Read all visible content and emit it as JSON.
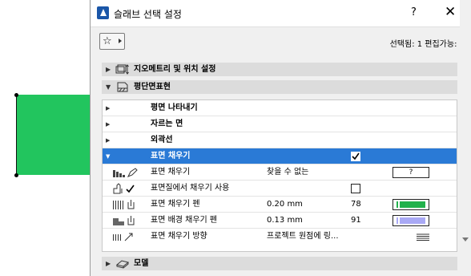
{
  "dialog": {
    "title": "슬래브 선택 설정",
    "help_label": "?",
    "close_label": "✕",
    "favorites_label": "☆",
    "selected_info": "선택됨: 1 편집가능: 1"
  },
  "sections": {
    "geometry": {
      "label": "지오메트리 및 위치 설정",
      "expanded": false
    },
    "floor_plan": {
      "label": "평단면표현",
      "expanded": true
    },
    "model": {
      "label": "모델",
      "expanded": false
    }
  },
  "tree": {
    "rows": [
      {
        "label": "평면 나타내기"
      },
      {
        "label": "자르는 면"
      },
      {
        "label": "외곽선"
      }
    ],
    "surface_fill": {
      "label": "표면 채우기",
      "checked": true
    }
  },
  "properties": [
    {
      "label": "표면 채우기",
      "value": "찾을 수 없는",
      "num": "",
      "pen_text": "?",
      "icon": "fill-pattern-icon"
    },
    {
      "label": "표면질에서 채우기 사용",
      "value": "",
      "num": "",
      "icon": "paint-bucket-icon"
    },
    {
      "label": "표면 채우기 펜",
      "value": "0.20 mm",
      "num": "78",
      "pen_color": "#22b14c",
      "icon": "pen-icon"
    },
    {
      "label": "표면 배경 채우기 펜",
      "value": "0.13 mm",
      "num": "91",
      "pen_color": "#a9a9f5",
      "icon": "background-pen-icon"
    },
    {
      "label": "표면 채우기 방향",
      "value": "프로젝트 원점에 링...",
      "num": "",
      "icon": "fill-direction-icon"
    }
  ],
  "colors": {
    "selection": "#2a7ad6",
    "shape_fill": "#22c55e"
  }
}
